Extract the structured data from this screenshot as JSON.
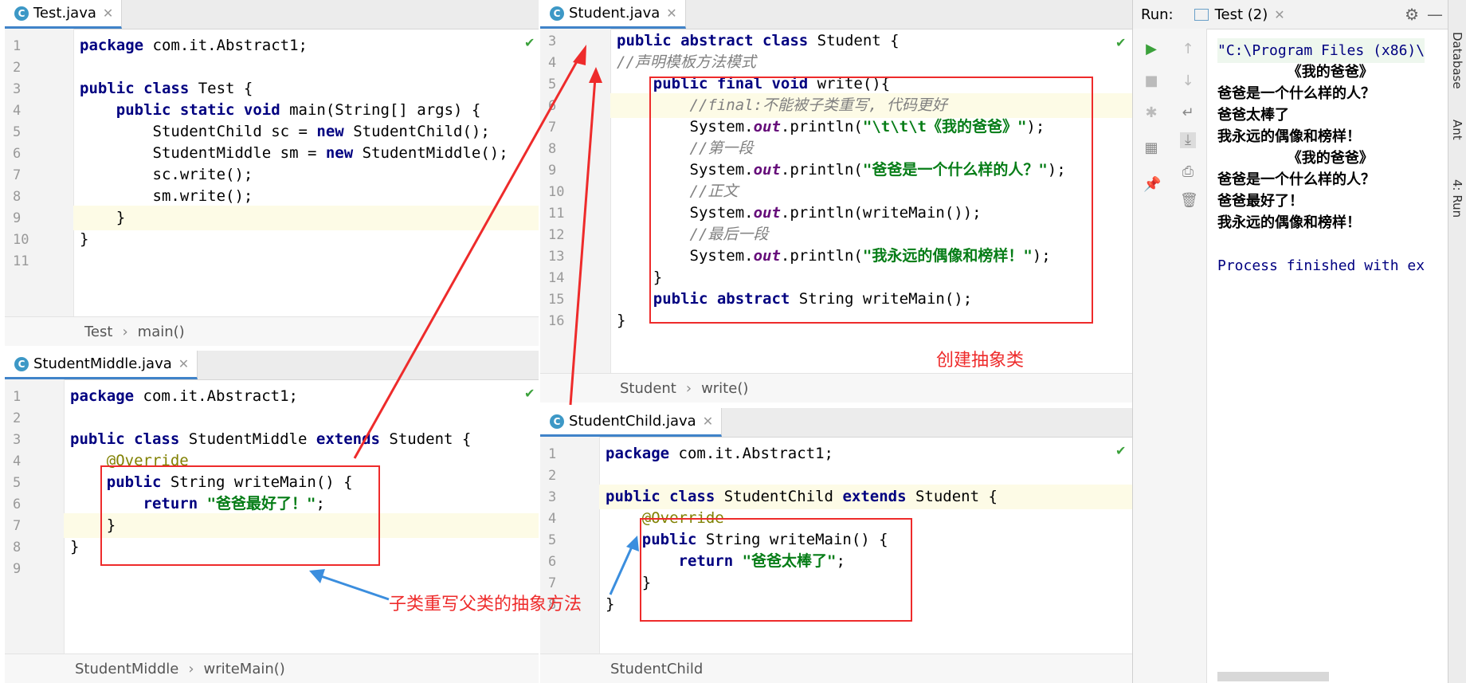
{
  "panes": {
    "test": {
      "tab": "Test.java",
      "lines": [
        "1",
        "2",
        "3",
        "4",
        "5",
        "6",
        "7",
        "8",
        "9",
        "10",
        "11"
      ],
      "code": [
        [
          [
            "kw",
            "package "
          ],
          [
            "",
            "com.it.Abstract1;"
          ]
        ],
        [],
        [
          [
            "kw",
            "public class "
          ],
          [
            "",
            "Test {"
          ]
        ],
        [
          [
            "",
            "    "
          ],
          [
            "kw",
            "public static void "
          ],
          [
            "",
            "main(String[] args) {"
          ]
        ],
        [
          [
            "",
            "        StudentChild sc = "
          ],
          [
            "kw",
            "new "
          ],
          [
            "",
            "StudentChild();"
          ]
        ],
        [
          [
            "",
            "        StudentMiddle sm = "
          ],
          [
            "kw",
            "new "
          ],
          [
            "",
            "StudentMiddle();"
          ]
        ],
        [
          [
            "",
            "        sc.write();"
          ]
        ],
        [
          [
            "",
            "        sm.write();"
          ]
        ],
        [
          [
            "",
            "    }"
          ]
        ],
        [
          [
            "",
            "}"
          ]
        ],
        []
      ],
      "breadcrumb": [
        "Test",
        "main()"
      ]
    },
    "middle": {
      "tab": "StudentMiddle.java",
      "lines": [
        "1",
        "2",
        "3",
        "4",
        "5",
        "6",
        "7",
        "8",
        "9"
      ],
      "code": [
        [
          [
            "kw",
            "package "
          ],
          [
            "",
            "com.it.Abstract1;"
          ]
        ],
        [],
        [
          [
            "kw",
            "public class "
          ],
          [
            "",
            "StudentMiddle "
          ],
          [
            "kw",
            "extends "
          ],
          [
            "",
            "Student {"
          ]
        ],
        [
          [
            "",
            "    "
          ],
          [
            "an",
            "@Override"
          ]
        ],
        [
          [
            "",
            "    "
          ],
          [
            "kw",
            "public "
          ],
          [
            "",
            "String writeMain() {"
          ]
        ],
        [
          [
            "",
            "        "
          ],
          [
            "kw",
            "return "
          ],
          [
            "str",
            "\"爸爸最好了！\""
          ],
          [
            "",
            ";"
          ]
        ],
        [
          [
            "",
            "    }"
          ]
        ],
        [
          [
            "",
            "}"
          ]
        ],
        []
      ],
      "breadcrumb": [
        "StudentMiddle",
        "writeMain()"
      ]
    },
    "student": {
      "tab": "Student.java",
      "lines": [
        "3",
        "4",
        "5",
        "6",
        "7",
        "8",
        "9",
        "10",
        "11",
        "12",
        "13",
        "14",
        "15",
        "16"
      ],
      "code": [
        [
          [
            "kw",
            "public abstract class "
          ],
          [
            "",
            "Student {"
          ]
        ],
        [
          [
            "cm",
            "//声明模板方法模式"
          ]
        ],
        [
          [
            "",
            "    "
          ],
          [
            "kw",
            "public final void "
          ],
          [
            "",
            "write(){"
          ]
        ],
        [
          [
            "",
            "        "
          ],
          [
            "cm",
            "//final:不能被子类重写, 代码更好"
          ]
        ],
        [
          [
            "",
            "        System."
          ],
          [
            "fld",
            "out"
          ],
          [
            "",
            ".println("
          ],
          [
            "str",
            "\"\\t\\t\\t《我的爸爸》\""
          ],
          [
            "",
            ");"
          ]
        ],
        [
          [
            "",
            "        "
          ],
          [
            "cm",
            "//第一段"
          ]
        ],
        [
          [
            "",
            "        System."
          ],
          [
            "fld",
            "out"
          ],
          [
            "",
            ".println("
          ],
          [
            "str",
            "\"爸爸是一个什么样的人？\""
          ],
          [
            "",
            ");"
          ]
        ],
        [
          [
            "",
            "        "
          ],
          [
            "cm",
            "//正文"
          ]
        ],
        [
          [
            "",
            "        System."
          ],
          [
            "fld",
            "out"
          ],
          [
            "",
            ".println(writeMain());"
          ]
        ],
        [
          [
            "",
            "        "
          ],
          [
            "cm",
            "//最后一段"
          ]
        ],
        [
          [
            "",
            "        System."
          ],
          [
            "fld",
            "out"
          ],
          [
            "",
            ".println("
          ],
          [
            "str",
            "\"我永远的偶像和榜样！\""
          ],
          [
            "",
            ");"
          ]
        ],
        [
          [
            "",
            "    }"
          ]
        ],
        [
          [
            "",
            "    "
          ],
          [
            "kw",
            "public abstract "
          ],
          [
            "",
            "String writeMain();"
          ]
        ],
        [
          [
            "",
            "}"
          ]
        ]
      ],
      "breadcrumb": [
        "Student",
        "write()"
      ]
    },
    "child": {
      "tab": "StudentChild.java",
      "lines": [
        "1",
        "2",
        "3",
        "4",
        "5",
        "6",
        "7",
        "8"
      ],
      "code": [
        [
          [
            "kw",
            "package "
          ],
          [
            "",
            "com.it.Abstract1;"
          ]
        ],
        [],
        [
          [
            "kw",
            "public class "
          ],
          [
            "",
            "StudentChild "
          ],
          [
            "kw",
            "extends "
          ],
          [
            "",
            "Student {"
          ]
        ],
        [
          [
            "",
            "    "
          ],
          [
            "an",
            "@Override"
          ]
        ],
        [
          [
            "",
            "    "
          ],
          [
            "kw",
            "public "
          ],
          [
            "",
            "String writeMain() {"
          ]
        ],
        [
          [
            "",
            "        "
          ],
          [
            "kw",
            "return "
          ],
          [
            "str",
            "\"爸爸太棒了\""
          ],
          [
            "",
            ";"
          ]
        ],
        [
          [
            "",
            "    }"
          ]
        ],
        [
          [
            "",
            "}"
          ]
        ]
      ],
      "breadcrumb": [
        "StudentChild"
      ]
    }
  },
  "run": {
    "label": "Run:",
    "tab": "Test (2)",
    "output": [
      {
        "text": "\"C:\\Program Files (x86)\\",
        "style": "cmd"
      },
      {
        "text": "              《我的爸爸》",
        "style": "cjk"
      },
      {
        "text": "爸爸是一个什么样的人？",
        "style": "cjk"
      },
      {
        "text": "爸爸太棒了",
        "style": "cjk"
      },
      {
        "text": "我永远的偶像和榜样！",
        "style": "cjk"
      },
      {
        "text": "              《我的爸爸》",
        "style": "cjk"
      },
      {
        "text": "爸爸是一个什么样的人？",
        "style": "cjk"
      },
      {
        "text": "爸爸最好了！",
        "style": "cjk"
      },
      {
        "text": "我永远的偶像和榜样！",
        "style": "cjk"
      },
      {
        "text": "",
        "style": "cjk"
      },
      {
        "text": "Process finished with ex",
        "style": "proc"
      }
    ]
  },
  "sidebar": [
    "Database",
    "Ant",
    "4: Run"
  ],
  "annotations": {
    "create_abstract": "创建抽象类",
    "override_note": "子类重写父类的抽象方法"
  },
  "colors": {
    "red": "#ee2b2b",
    "blue": "#3b8ede"
  }
}
